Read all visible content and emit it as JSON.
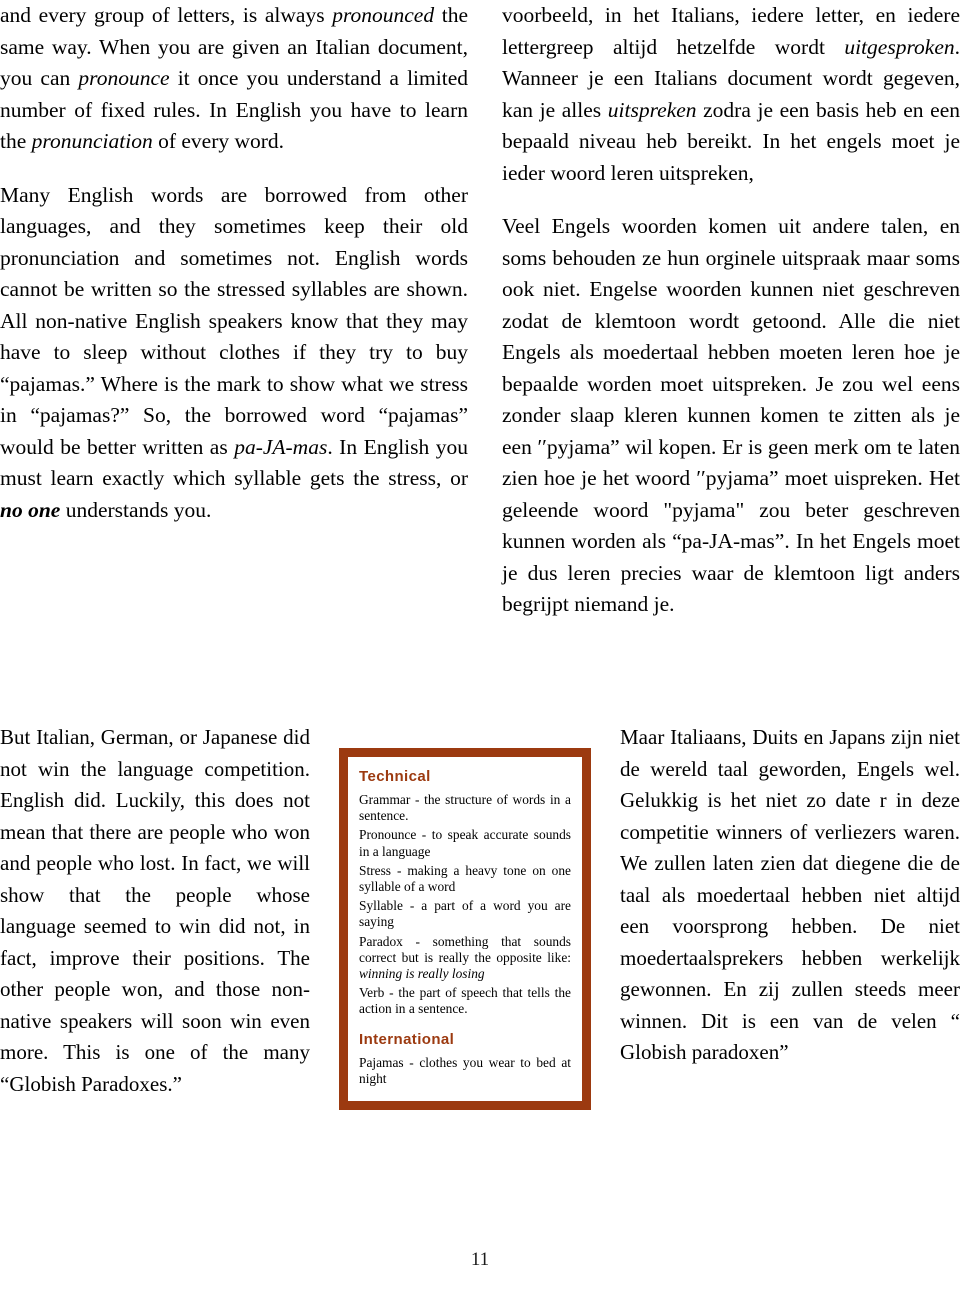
{
  "document": {
    "page_number": "11",
    "accent_color": "#9c3a10",
    "text_color": "#000000",
    "background_color": "#ffffff"
  },
  "left_column_top": {
    "paragraph_1_parts": [
      {
        "text": "and every group of letters, is always ",
        "style": "normal"
      },
      {
        "text": "pronounced",
        "style": "italic"
      },
      {
        "text": " the same way. When you are given an Italian document, you can ",
        "style": "normal"
      },
      {
        "text": "pronounce",
        "style": "italic"
      },
      {
        "text": " it once you understand a limited number of fixed rules. In English you have to learn the ",
        "style": "normal"
      },
      {
        "text": "pronunciation",
        "style": "italic"
      },
      {
        "text": " of every word.",
        "style": "normal"
      }
    ],
    "paragraph_2_parts": [
      {
        "text": "Many English words are borrowed from other languages, and they sometimes keep their old pronunciation and sometimes not. English words cannot be written so the stressed syllables are shown. All non-native English speakers know that they may have to sleep without clothes if they try to buy “pajamas.” Where is the mark to show what we stress in “pajamas?” So, the borrowed word “pajamas” would be better written as ",
        "style": "normal"
      },
      {
        "text": "pa-JA-mas",
        "style": "italic"
      },
      {
        "text": ". In English you must learn exactly which syllable gets the stress, or ",
        "style": "normal"
      },
      {
        "text": "no one",
        "style": "bold-italic"
      },
      {
        "text": " understands you.",
        "style": "normal"
      }
    ]
  },
  "right_column_top": {
    "paragraph_1_parts": [
      {
        "text": "voorbeeld, in het Italians, iedere letter, en iedere lettergreep altijd hetzelfde wordt ",
        "style": "normal"
      },
      {
        "text": "uitgesproken",
        "style": "italic"
      },
      {
        "text": ". Wanneer je een Italians document wordt gegeven, kan je alles ",
        "style": "normal"
      },
      {
        "text": "uitspreken",
        "style": "italic"
      },
      {
        "text": " zodra je een basis heb en een bepaald niveau heb bereikt. In het engels moet je ieder woord leren uitspreken,",
        "style": "normal"
      }
    ],
    "paragraph_2_parts": [
      {
        "text": "Veel Engels woorden komen uit andere talen, en soms behouden ze hun orginele uitspraak maar soms ook niet. Engelse woorden kunnen niet geschreven zodat de klemtoon wordt getoond. Alle die niet Engels als moedertaal hebben moeten leren hoe je bepaalde worden moet uitspreken. Je zou wel eens zonder slaap kleren kunnen komen te zitten als je een ′′pyjama” wil kopen. Er is geen merk om te laten zien hoe je het woord ′′pyjama” moet uispreken. Het geleende woord \"pyjama\" zou beter geschreven kunnen worden als “pa-JA-mas”. In het Engels moet je dus leren precies waar de klemtoon ligt anders begrijpt niemand je.",
        "style": "normal"
      }
    ]
  },
  "left_column_bottom": {
    "paragraph_parts": [
      {
        "text": "But Italian, German, or Japanese did not win the language competition. English did. Luckily, this does not mean that there are people who won and people who lost. In fact, we will show that the people whose language seemed to win did not, in fact, improve their positions. The other people won, and those non-native speakers will soon win even more. This is one of the many “Globish Paradoxes.”",
        "style": "normal"
      }
    ]
  },
  "right_column_bottom": {
    "paragraph_parts": [
      {
        "text": "Maar Italiaans, Duits en Japans zijn niet de wereld taal geworden, Engels wel. Gelukkig is het niet zo date r in deze competitie winners of verliezers waren. We zullen laten zien dat diegene die de taal als moedertaal hebben niet altijd een voorsprong hebben. De niet moedertaalsprekers hebben werkelijk gewonnen. En zij zullen steeds meer winnen. Dit is een van de velen “ Globish paradoxen”",
        "style": "normal"
      }
    ]
  },
  "technical_box": {
    "border_color": "#9c3a10",
    "heading_technical": "Technical",
    "entries_technical": [
      "Grammar - the structure of words in a sentence.",
      "Pronounce - to speak accurate sounds in a language",
      "Stress - making a heavy tone on one syllable of a word",
      "Syllable - a part of a word you are saying"
    ],
    "paradox_entry_prefix": "Paradox - something that sounds correct but is really     the     opposite like: ",
    "paradox_entry_italic": "winning is really losing",
    "verb_entry": "Verb - the part of speech that tells the action in a sentence.",
    "heading_international": "International",
    "entries_international": [
      "Pajamas - clothes you wear to bed at night"
    ]
  }
}
